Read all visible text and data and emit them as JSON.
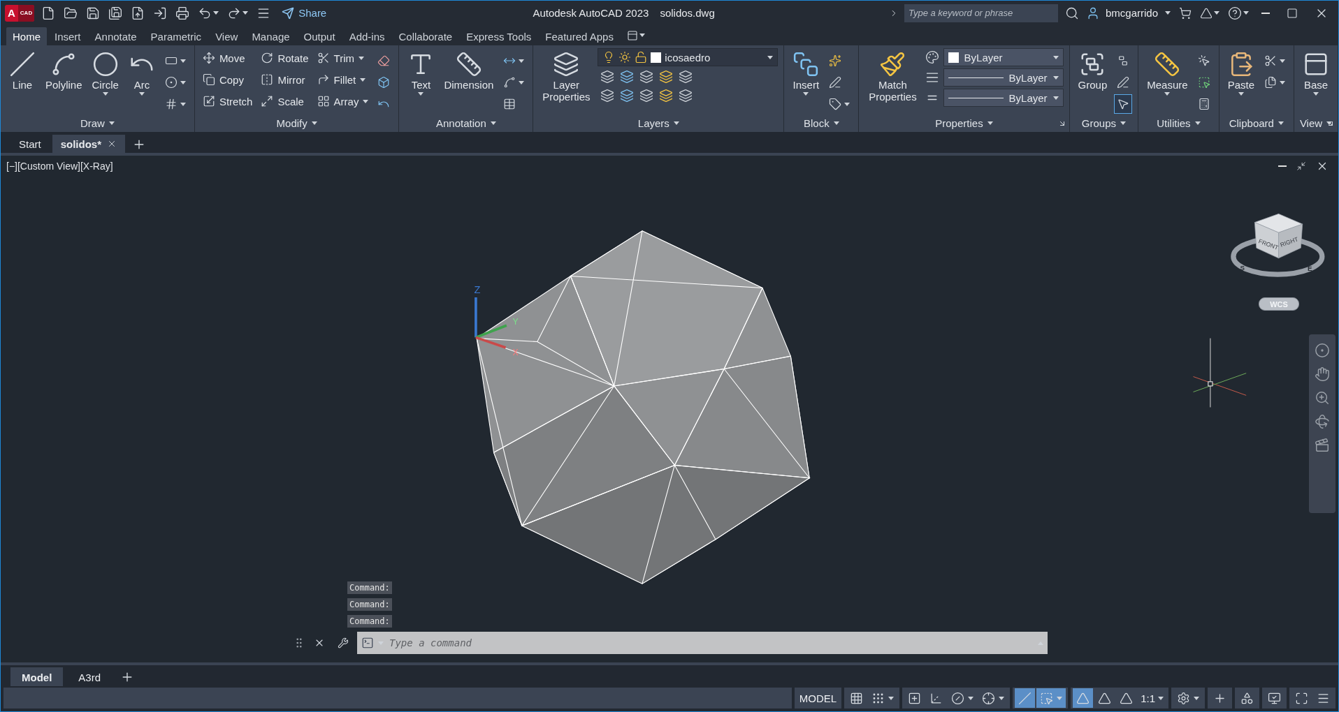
{
  "app_logo": {
    "letter": "A",
    "product": "CAD"
  },
  "quick_access": {
    "share": "Share"
  },
  "title": {
    "app": "Autodesk AutoCAD 2023",
    "file": "solidos.dwg"
  },
  "search": {
    "placeholder": "Type a keyword or phrase"
  },
  "user": {
    "name": "bmcgarrido"
  },
  "ribbon_tabs": [
    {
      "label": "Home",
      "selected": true
    },
    {
      "label": "Insert",
      "selected": false
    },
    {
      "label": "Annotate",
      "selected": false
    },
    {
      "label": "Parametric",
      "selected": false
    },
    {
      "label": "View",
      "selected": false
    },
    {
      "label": "Manage",
      "selected": false
    },
    {
      "label": "Output",
      "selected": false
    },
    {
      "label": "Add-ins",
      "selected": false
    },
    {
      "label": "Collaborate",
      "selected": false
    },
    {
      "label": "Express Tools",
      "selected": false
    },
    {
      "label": "Featured Apps",
      "selected": false
    }
  ],
  "ribbon_panels": [
    {
      "title": "Draw",
      "launcher": false,
      "columns": [
        [
          {
            "kind": "large",
            "label": "Line",
            "dropdown": false
          }
        ],
        [
          {
            "kind": "large",
            "label": "Polyline",
            "dropdown": false
          }
        ],
        [
          {
            "kind": "large",
            "label": "Circle",
            "dropdown": true
          }
        ],
        [
          {
            "kind": "large",
            "label": "Arc",
            "dropdown": true
          }
        ],
        [
          {
            "kind": "icon",
            "dropdown": true
          },
          {
            "kind": "icon",
            "dropdown": true
          },
          {
            "kind": "icon",
            "dropdown": true
          }
        ]
      ]
    },
    {
      "title": "Modify",
      "launcher": false,
      "columns": [
        [
          {
            "kind": "small",
            "label": "Move",
            "dropdown": false
          },
          {
            "kind": "small",
            "label": "Copy",
            "dropdown": false
          },
          {
            "kind": "small",
            "label": "Stretch",
            "dropdown": false
          }
        ],
        [
          {
            "kind": "small",
            "label": "Rotate",
            "dropdown": false
          },
          {
            "kind": "small",
            "label": "Mirror",
            "dropdown": false
          },
          {
            "kind": "small",
            "label": "Scale",
            "dropdown": false
          }
        ],
        [
          {
            "kind": "small",
            "label": "Trim",
            "dropdown": true
          },
          {
            "kind": "small",
            "label": "Fillet",
            "dropdown": true
          },
          {
            "kind": "small",
            "label": "Array",
            "dropdown": true
          }
        ],
        [
          {
            "kind": "icon",
            "dropdown": false
          },
          {
            "kind": "icon",
            "dropdown": false
          },
          {
            "kind": "icon",
            "dropdown": false
          }
        ]
      ]
    },
    {
      "title": "Annotation",
      "launcher": false,
      "columns": [
        [
          {
            "kind": "large",
            "label": "Text",
            "dropdown": true
          }
        ],
        [
          {
            "kind": "large",
            "label": "Dimension",
            "dropdown": false
          }
        ],
        [
          {
            "kind": "icon",
            "dropdown": true
          },
          {
            "kind": "icon",
            "dropdown": true
          },
          {
            "kind": "icon",
            "dropdown": false
          }
        ]
      ]
    },
    {
      "title": "Layers",
      "launcher": false,
      "columns": [
        [
          {
            "kind": "large",
            "label": "Layer Properties",
            "dropdown": false
          }
        ],
        [
          {
            "kind": "layer",
            "value": "icosaedro"
          }
        ]
      ]
    },
    {
      "title": "Block",
      "launcher": false,
      "columns": [
        [
          {
            "kind": "large",
            "label": "Insert",
            "dropdown": true
          }
        ],
        [
          {
            "kind": "icon",
            "dropdown": false
          },
          {
            "kind": "icon",
            "dropdown": false
          },
          {
            "kind": "icon",
            "dropdown": true
          }
        ]
      ]
    },
    {
      "title": "Properties",
      "launcher": true,
      "columns": [
        [
          {
            "kind": "large",
            "label": "Match Properties",
            "dropdown": false
          }
        ],
        [
          {
            "kind": "color-select",
            "value": "ByLayer"
          },
          {
            "kind": "line-select",
            "value": "ByLayer"
          },
          {
            "kind": "line-select",
            "value": "ByLayer"
          }
        ]
      ]
    },
    {
      "title": "Groups",
      "launcher": false,
      "columns": [
        [
          {
            "kind": "large",
            "label": "Group",
            "dropdown": false
          }
        ],
        [
          {
            "kind": "icon",
            "dropdown": false,
            "on": false
          },
          {
            "kind": "icon",
            "dropdown": false,
            "on": false
          },
          {
            "kind": "icon",
            "dropdown": false,
            "on": true
          }
        ]
      ]
    },
    {
      "title": "Utilities",
      "launcher": false,
      "columns": [
        [
          {
            "kind": "large",
            "label": "Measure",
            "dropdown": true
          }
        ],
        [
          {
            "kind": "icon",
            "dropdown": false
          },
          {
            "kind": "icon",
            "dropdown": false
          },
          {
            "kind": "icon",
            "dropdown": false
          }
        ]
      ]
    },
    {
      "title": "Clipboard",
      "launcher": false,
      "columns": [
        [
          {
            "kind": "large",
            "label": "Paste",
            "dropdown": true
          }
        ],
        [
          {
            "kind": "icon",
            "dropdown": true
          },
          {
            "kind": "icon",
            "dropdown": true
          }
        ]
      ]
    },
    {
      "title": "View",
      "launcher": true,
      "columns": [
        [
          {
            "kind": "large",
            "label": "Base",
            "dropdown": true
          }
        ]
      ]
    }
  ],
  "file_tabs": [
    {
      "label": "Start",
      "selected": false,
      "closable": false
    },
    {
      "label": "solidos*",
      "selected": true,
      "closable": true
    }
  ],
  "viewport": {
    "label": "[−][Custom View][X-Ray]",
    "cube_faces": [
      "FRONT",
      "RIGHT"
    ],
    "compass": [
      "S",
      "E"
    ],
    "ucs_menu": "WCS",
    "ucs_axes": [
      "Z",
      "Y",
      "X"
    ]
  },
  "command_history": [
    "Command:",
    "Command:",
    "Command:"
  ],
  "command_line": {
    "placeholder": "Type a command"
  },
  "layout_tabs": [
    {
      "label": "Model",
      "selected": true
    },
    {
      "label": "A3rd",
      "selected": false
    }
  ],
  "status_bar": {
    "groups": [
      [
        {
          "kind": "text",
          "label": "MODEL",
          "dropdown": false
        }
      ],
      [
        {
          "kind": "toggle",
          "on": false,
          "dropdown": false
        },
        {
          "kind": "toggle",
          "on": false,
          "dropdown": true
        }
      ],
      [
        {
          "kind": "toggle",
          "on": false,
          "dropdown": false
        },
        {
          "kind": "toggle",
          "on": false,
          "dropdown": false
        },
        {
          "kind": "toggle",
          "on": false,
          "dropdown": true
        },
        {
          "kind": "toggle",
          "on": false,
          "dropdown": true
        }
      ],
      [
        {
          "kind": "toggle",
          "on": true,
          "dropdown": false
        },
        {
          "kind": "toggle",
          "on": true,
          "dropdown": true
        }
      ],
      [
        {
          "kind": "toggle",
          "on": true,
          "dropdown": false
        },
        {
          "kind": "toggle",
          "on": false,
          "dropdown": false
        },
        {
          "kind": "toggle",
          "on": false,
          "dropdown": false
        },
        {
          "kind": "text",
          "label": "1:1",
          "dropdown": true
        }
      ],
      [
        {
          "kind": "toggle",
          "on": false,
          "dropdown": true
        }
      ],
      [
        {
          "kind": "toggle",
          "on": false,
          "dropdown": false
        }
      ],
      [
        {
          "kind": "toggle",
          "on": false,
          "dropdown": false
        }
      ],
      [
        {
          "kind": "toggle",
          "on": false,
          "dropdown": false
        }
      ],
      [
        {
          "kind": "toggle",
          "on": false,
          "dropdown": false
        },
        {
          "kind": "toggle",
          "on": false,
          "dropdown": false
        }
      ]
    ]
  }
}
